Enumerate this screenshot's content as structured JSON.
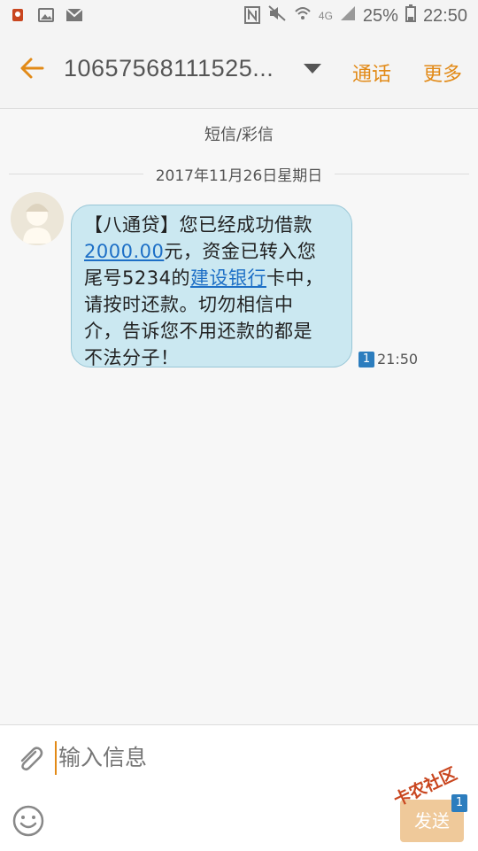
{
  "status_bar": {
    "network": "4G",
    "battery": "25%",
    "time": "22:50"
  },
  "app_bar": {
    "title": "10657568111525...",
    "call_label": "通话",
    "more_label": "更多"
  },
  "conversation": {
    "channel_label": "短信/彩信",
    "date": "2017年11月26日星期日"
  },
  "message": {
    "line1": "【八通贷】您已经成功借款",
    "amount": "2000.00",
    "line2_rest": "元，资金已转入您",
    "line3_pre": "尾号5234的",
    "bank": "建设银行",
    "line3_post": "卡中，",
    "line4": "请按时还款。切勿相信中",
    "line5": "介，告诉您不用还款的都是",
    "line6": "不法分子！",
    "sim": "1",
    "time": "21:50"
  },
  "composer": {
    "placeholder": "输入信息",
    "send_label": "发送",
    "sim": "1"
  },
  "watermark": {
    "text": "卡农社区"
  },
  "icons": [
    "notification-app-icon",
    "gallery-icon",
    "mail-icon",
    "nfc-icon",
    "mute-icon",
    "wifi-icon",
    "signal-icon",
    "battery-icon",
    "back-arrow-icon",
    "dropdown-arrow-icon",
    "attach-icon",
    "emoji-icon"
  ],
  "colors": {
    "accent": "#e28a17",
    "bubble": "#cbe8f1",
    "link": "#1d6fc6",
    "sim_badge": "#2c7dbe"
  }
}
